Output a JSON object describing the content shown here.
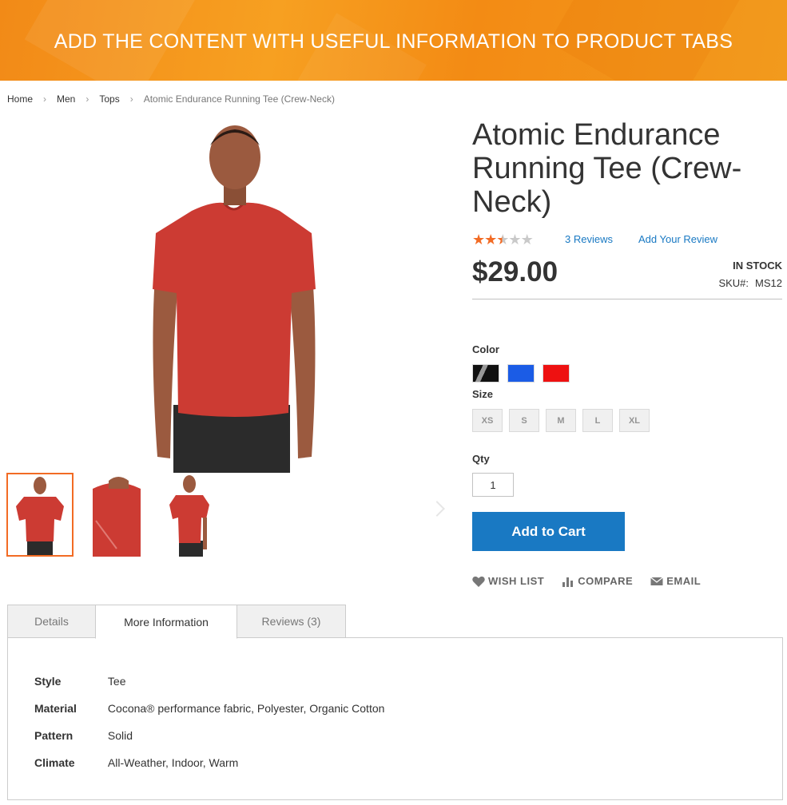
{
  "banner": {
    "text": "ADD THE CONTENT WITH USEFUL INFORMATION TO PRODUCT TABS"
  },
  "breadcrumb": [
    "Home",
    "Men",
    "Tops",
    "Atomic Endurance Running Tee (Crew-Neck)"
  ],
  "product": {
    "title": "Atomic Endurance Running Tee (Crew-Neck)",
    "rating_stars": 2.5,
    "rating_max": 5,
    "reviews_link": "3 Reviews",
    "add_review_link": "Add Your Review",
    "price": "$29.00",
    "stock": "IN STOCK",
    "sku_label": "SKU#:",
    "sku_value": "MS12"
  },
  "options": {
    "color_label": "Color",
    "colors": [
      "#111111",
      "#1b5ce6",
      "#ee1111"
    ],
    "size_label": "Size",
    "sizes": [
      "XS",
      "S",
      "M",
      "L",
      "XL"
    ],
    "qty_label": "Qty",
    "qty_value": "1"
  },
  "buttons": {
    "add_to_cart": "Add to Cart"
  },
  "actions": {
    "wishlist": "WISH LIST",
    "compare": "COMPARE",
    "email": "EMAIL"
  },
  "tabs": [
    {
      "label": "Details"
    },
    {
      "label": "More Information"
    },
    {
      "label": "Reviews (3)"
    }
  ],
  "more_info": [
    {
      "label": "Style",
      "value": "Tee"
    },
    {
      "label": "Material",
      "value": "Cocona® performance fabric, Polyester, Organic Cotton"
    },
    {
      "label": "Pattern",
      "value": "Solid"
    },
    {
      "label": "Climate",
      "value": "All-Weather, Indoor, Warm"
    }
  ],
  "colors": {
    "brand_orange": "#f7941e",
    "accent_blue": "#1979c3",
    "star_orange": "#f26b24"
  }
}
